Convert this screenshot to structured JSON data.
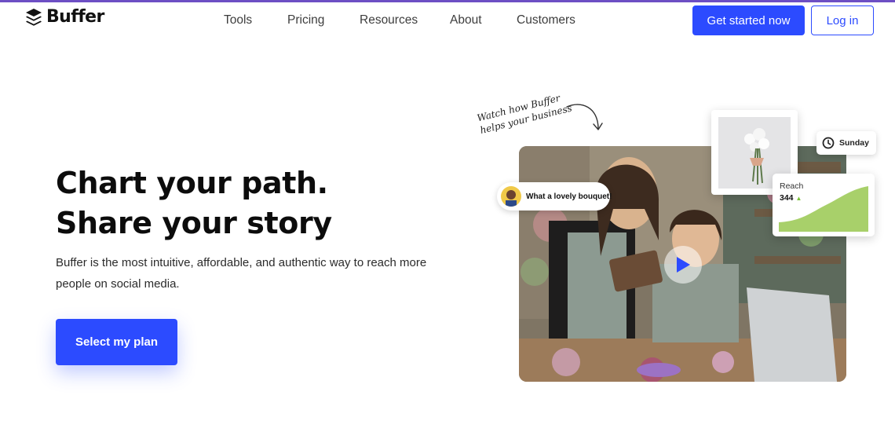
{
  "brand": {
    "name": "Buffer",
    "accent": "#2c4bff",
    "topline": "#6d4fc4"
  },
  "nav": {
    "items": [
      "Tools",
      "Pricing",
      "Resources",
      "About",
      "Customers"
    ],
    "cta_primary": "Get started now",
    "cta_secondary": "Log in"
  },
  "hero": {
    "headline_line1": "Chart your path.",
    "headline_line2": "Share your story",
    "subtext": "Buffer is the most intuitive, affordable, and authentic way to reach more people on social media.",
    "cta": "Select my plan"
  },
  "media": {
    "annotation_line1": "Watch how Buffer",
    "annotation_line2": "helps your business",
    "comment": "What a lovely bouquet!",
    "schedule_day": "Sunday",
    "reach_label": "Reach",
    "reach_value": "344",
    "reach_trend": "▲",
    "reach_color": "#a8d06a",
    "icons": [
      "buffer-logo-icon",
      "play-icon",
      "clock-icon",
      "curved-arrow-icon"
    ]
  }
}
